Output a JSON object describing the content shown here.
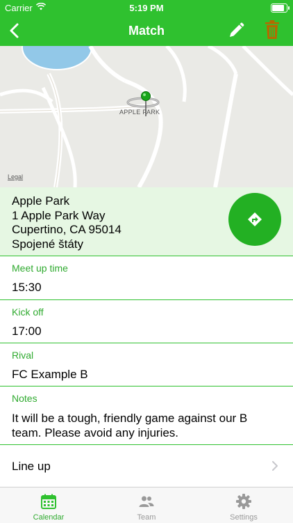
{
  "status_bar": {
    "carrier": "Carrier",
    "time": "5:19 PM",
    "battery_level": 0.95
  },
  "navbar": {
    "title": "Match",
    "back_icon": "chevron-left-icon",
    "edit_icon": "pencil-icon",
    "delete_icon": "trash-icon",
    "tint_color": "#2fc12f",
    "delete_color": "#b46a00"
  },
  "map": {
    "pin_label": "APPLE PARK",
    "legal_label": "Legal"
  },
  "address": {
    "lines": [
      "Apple Park",
      "1 Apple Park Way",
      "Cupertino, CA  95014",
      "Spojené štáty"
    ],
    "directions_icon": "directions-icon"
  },
  "fields": {
    "meetup": {
      "label": "Meet up time",
      "value": "15:30"
    },
    "kickoff": {
      "label": "Kick off",
      "value": "17:00"
    },
    "rival": {
      "label": "Rival",
      "value": "FC Example B"
    },
    "notes": {
      "label": "Notes",
      "value": "It will be a tough, friendly game against our B team. Please avoid any injuries."
    }
  },
  "lineup": {
    "label": "Line up"
  },
  "tabbar": {
    "tabs": [
      {
        "label": "Calendar",
        "icon": "calendar-icon",
        "active": true
      },
      {
        "label": "Team",
        "icon": "team-icon",
        "active": false
      },
      {
        "label": "Settings",
        "icon": "gear-icon",
        "active": false
      }
    ]
  }
}
